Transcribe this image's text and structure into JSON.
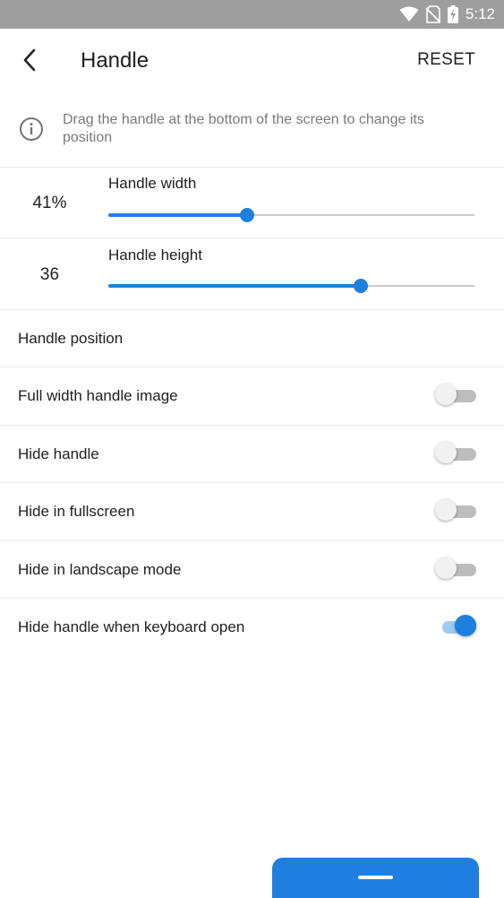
{
  "status_bar": {
    "time": "5:12",
    "icons": [
      "wifi-icon",
      "no-sim-icon",
      "battery-charging-icon"
    ]
  },
  "toolbar": {
    "title": "Handle",
    "reset_label": "RESET",
    "back_icon": "chevron-left-icon"
  },
  "info": {
    "icon": "info-circle-icon",
    "text": "Drag the handle at the bottom of the screen to change its position"
  },
  "sliders": [
    {
      "label": "Handle width",
      "value_text": "41%",
      "fraction": 0.38
    },
    {
      "label": "Handle height",
      "value_text": "36",
      "fraction": 0.69
    }
  ],
  "handle_position_label": "Handle position",
  "toggles": [
    {
      "label": "Full width handle image",
      "on": false
    },
    {
      "label": "Hide handle",
      "on": false
    },
    {
      "label": "Hide in fullscreen",
      "on": false
    },
    {
      "label": "Hide in landscape mode",
      "on": false
    },
    {
      "label": "Hide handle when keyboard open",
      "on": true
    }
  ],
  "colors": {
    "accent": "#1e7fe0",
    "status_bar": "#9e9e9e",
    "text_primary": "#212121",
    "text_secondary": "#7a7a7a"
  }
}
